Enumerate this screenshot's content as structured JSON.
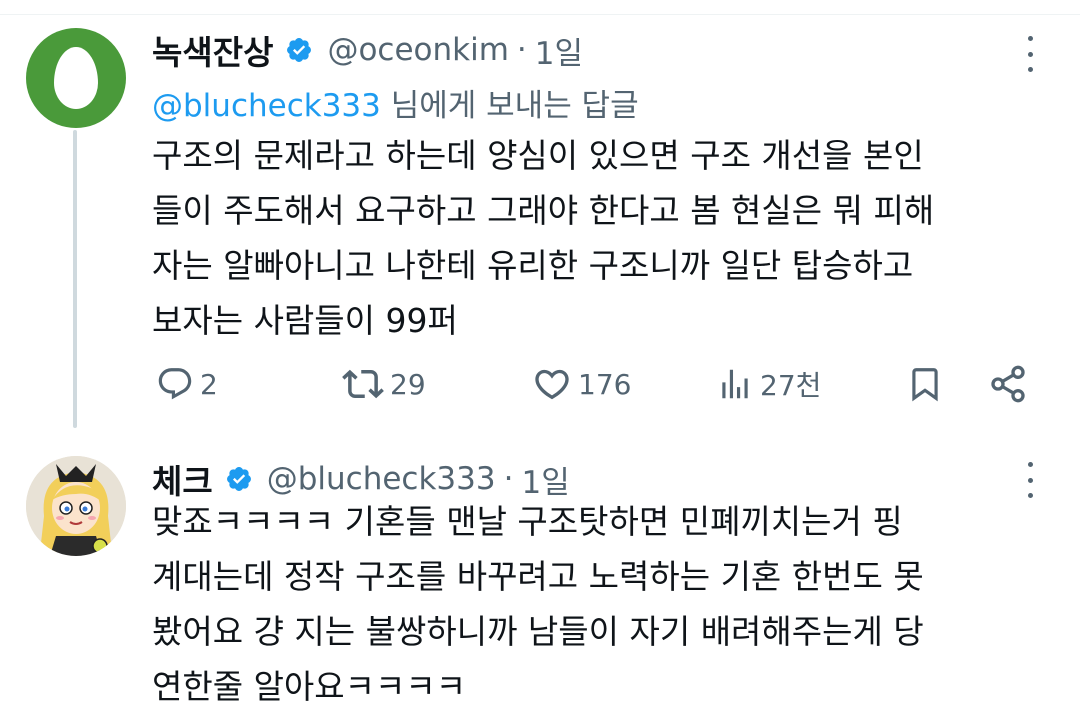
{
  "tweet1": {
    "display_name": "녹색잔상",
    "handle": "@oceonkim",
    "separator": "·",
    "time": "1일",
    "reply_prefix": "@blucheck333",
    "reply_suffix": "님에게 보내는 답글",
    "lines": [
      "구조의 문제라고 하는데 양심이 있으면 구조 개선을 본인",
      "들이 주도해서 요구하고 그래야 한다고 봄 현실은 뭐 피해",
      "자는 알빠아니고 나한테 유리한 구조니까 일단 탑승하고",
      "보자는 사람들이 99퍼"
    ],
    "replies_count": "2",
    "retweets_count": "29",
    "likes_count": "176",
    "views_count": "27천"
  },
  "tweet2": {
    "display_name": "체크",
    "handle": "@blucheck333",
    "separator": "·",
    "time": "1일",
    "lines": [
      "맞죠ㅋㅋㅋㅋ 기혼들 맨날 구조탓하면 민폐끼치는거 핑",
      "계대는데 정작 구조를 바꾸려고 노력하는 기혼 한번도 못",
      "봤어요 걍 지는 불쌍하니까 남들이 자기 배려해주는게 당",
      "연한줄 알아요ㅋㅋㅋㅋ"
    ]
  },
  "colors": {
    "text": "#0f1419",
    "secondary": "#536471",
    "link": "#1d9bf0",
    "verified": "#1d9bf0",
    "avatar_green": "#4a9a3a",
    "thread_line": "#cfd9de"
  },
  "icons": [
    "verified-badge-icon",
    "more-icon",
    "reply-icon",
    "retweet-icon",
    "like-icon",
    "views-icon",
    "bookmark-icon",
    "share-icon"
  ]
}
